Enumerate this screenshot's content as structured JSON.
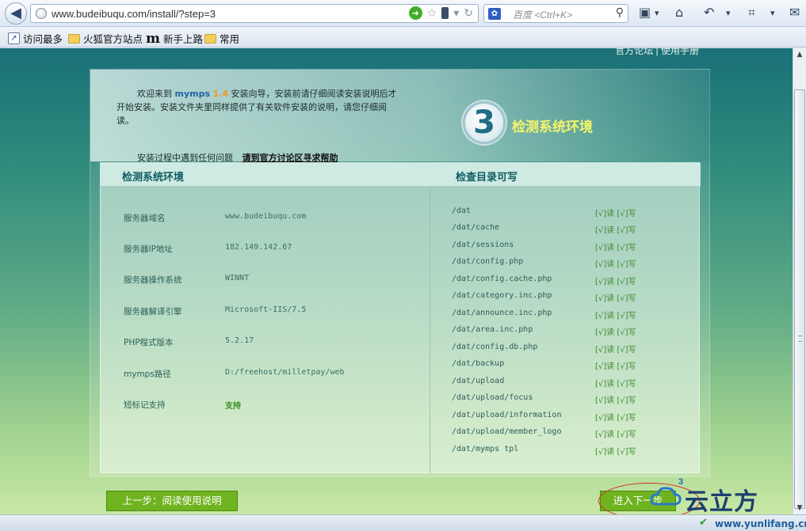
{
  "browser": {
    "url": "www.budeibuqu.com/install/?step=3",
    "search_placeholder": "百度 <Ctrl+K>",
    "bookmarks": [
      "访问最多",
      "火狐官方站点",
      "新手上路",
      "常用"
    ],
    "icons": [
      "back-arrow-icon",
      "globe-icon",
      "go-icon",
      "star-icon",
      "phone-icon",
      "dropdown-icon",
      "reload-icon",
      "baidu-paw-icon",
      "search-icon",
      "bookmark-list-icon",
      "home-icon",
      "undo-icon",
      "crop-icon",
      "chat-icon"
    ]
  },
  "page": {
    "topnav": "官方论坛 | 使用手册",
    "intro": {
      "prefix": "欢迎来到",
      "brand": "mymps",
      "version": "1.4",
      "suffix": "安装向导，安装前请仔细阅读安装说明后才开始安装。安装文件夹里同样提供了有关软件安装的说明，请您仔细阅读。",
      "help_text": "安装过程中遇到任何问题",
      "help_link": "请到官方讨论区寻求帮助"
    },
    "step": {
      "number": "3",
      "title": "检测系统环境"
    },
    "columns": {
      "left": "检测系统环境",
      "right": "检查目录可写"
    },
    "environment": [
      {
        "label": "服务器域名",
        "value": "www.budeibuqu.com"
      },
      {
        "label": "服务器IP地址",
        "value": "182.149.142.67"
      },
      {
        "label": "服务器操作系统",
        "value": "WINNT"
      },
      {
        "label": "服务器解译引擎",
        "value": "Microsoft-IIS/7.5"
      },
      {
        "label": "PHP程式版本",
        "value": "5.2.17"
      },
      {
        "label": "mymps路径",
        "value": "D:/freehost/milletpay/web"
      },
      {
        "label": "短标记支持",
        "value": "支持"
      }
    ],
    "directories": [
      {
        "path": "/dat",
        "status": "[√]读 [√]写"
      },
      {
        "path": "/dat/cache",
        "status": "[√]读 [√]写"
      },
      {
        "path": "/dat/sessions",
        "status": "[√]读 [√]写"
      },
      {
        "path": "/dat/config.php",
        "status": "[√]读 [√]写"
      },
      {
        "path": "/dat/config.cache.php",
        "status": "[√]读 [√]写"
      },
      {
        "path": "/dat/category.inc.php",
        "status": "[√]读 [√]写"
      },
      {
        "path": "/dat/announce.inc.php",
        "status": "[√]读 [√]写"
      },
      {
        "path": "/dat/area.inc.php",
        "status": "[√]读 [√]写"
      },
      {
        "path": "/dat/config.db.php",
        "status": "[√]读 [√]写"
      },
      {
        "path": "/dat/backup",
        "status": "[√]读 [√]写"
      },
      {
        "path": "/dat/upload",
        "status": "[√]读 [√]写"
      },
      {
        "path": "/dat/upload/focus",
        "status": "[√]读 [√]写"
      },
      {
        "path": "/dat/upload/information",
        "status": "[√]读 [√]写"
      },
      {
        "path": "/dat/upload/member_logo",
        "status": "[√]读 [√]写"
      },
      {
        "path": "/dat/mymps tpl",
        "status": "[√]读 [√]写"
      }
    ],
    "buttons": {
      "prev": "上一步：阅读使用说明",
      "next": "进入下一步"
    }
  },
  "watermark": {
    "brand": "云立方",
    "sup": "3",
    "url": "www.yunlifang.cn"
  },
  "colors": {
    "accent_green": "#6fb420",
    "step_title": "#f4f46a",
    "ok_green": "#3f8a2d",
    "annotation_red": "#d42a2a"
  }
}
